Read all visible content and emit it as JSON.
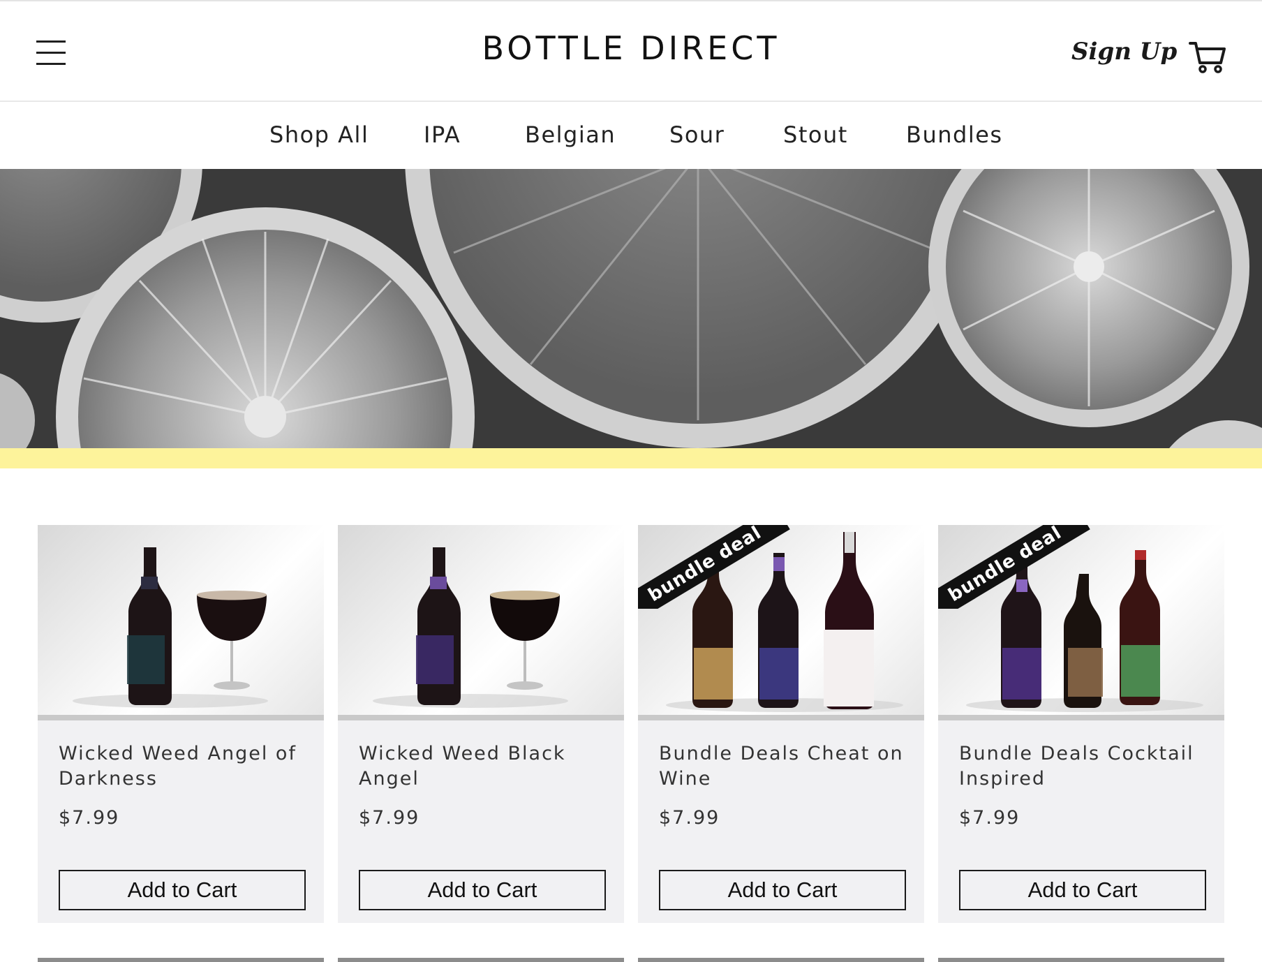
{
  "header": {
    "brand": "BOTTLE DIRECT",
    "signup_label": "Sign Up",
    "menu_icon": "hamburger-menu-icon",
    "cart_icon": "shopping-cart-icon"
  },
  "nav": {
    "items": [
      {
        "label": "Shop All"
      },
      {
        "label": "IPA"
      },
      {
        "label": "Belgian"
      },
      {
        "label": "Sour"
      },
      {
        "label": "Stout"
      },
      {
        "label": "Bundles"
      }
    ]
  },
  "hero": {
    "accent_stripe_color": "#fdf39b"
  },
  "products": [
    {
      "title": "Wicked Weed Angel of Darkness",
      "price": "$7.99",
      "button_label": "Add to Cart",
      "badge": ""
    },
    {
      "title": "Wicked Weed Black Angel",
      "price": "$7.99",
      "button_label": "Add to Cart",
      "badge": ""
    },
    {
      "title": "Bundle Deals Cheat on Wine",
      "price": "$7.99",
      "button_label": "Add to Cart",
      "badge": "bundle deal"
    },
    {
      "title": "Bundle Deals Cocktail Inspired",
      "price": "$7.99",
      "button_label": "Add to Cart",
      "badge": "bundle deal"
    }
  ]
}
